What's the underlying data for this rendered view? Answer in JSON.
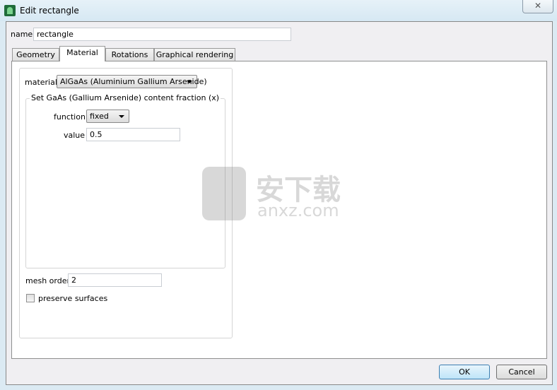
{
  "window": {
    "title": "Edit rectangle",
    "close_icon": "close-icon"
  },
  "name_field": {
    "label": "name",
    "value": "rectangle"
  },
  "tabs": [
    {
      "label": "Geometry"
    },
    {
      "label": "Material",
      "active": true
    },
    {
      "label": "Rotations"
    },
    {
      "label": "Graphical rendering"
    }
  ],
  "material": {
    "label": "material",
    "selected": "AlGaAs (Aluminium Gallium Arsenide)",
    "group_title": "Set GaAs (Gallium Arsenide) content fraction (x)",
    "function_label": "function",
    "function_value": "fixed",
    "value_label": "value",
    "value": "0.5",
    "mesh_order_label": "mesh order",
    "mesh_order": "2",
    "preserve_surfaces_label": "preserve surfaces",
    "preserve_surfaces": false
  },
  "buttons": {
    "ok": "OK",
    "cancel": "Cancel"
  },
  "watermark": {
    "text": "安下载",
    "sub": "anxz.com"
  }
}
